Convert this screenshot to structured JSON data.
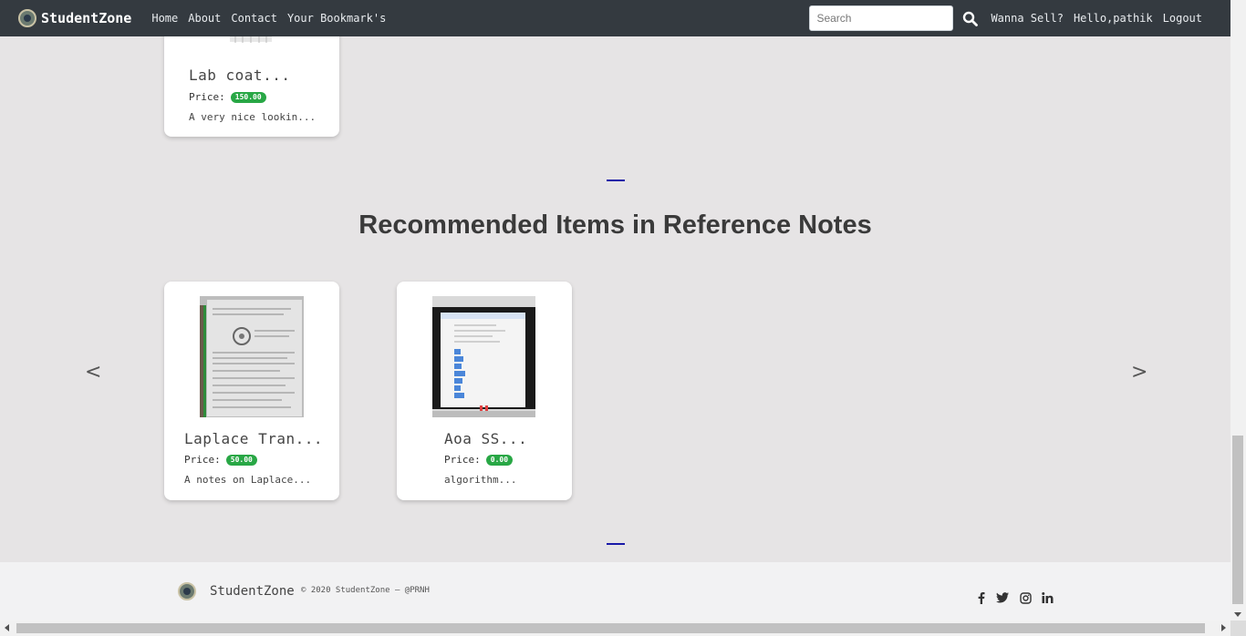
{
  "navbar": {
    "brand": "StudentZone",
    "links": [
      "Home",
      "About",
      "Contact",
      "Your Bookmark's"
    ],
    "search_placeholder": "Search",
    "right": [
      "Wanna Sell?",
      "Hello,pathik",
      "Logout"
    ]
  },
  "previous_section": {
    "cards": [
      {
        "title": "Lab coat...",
        "price_label": "Price:",
        "price": "150.00",
        "desc": "A very nice lookin..."
      }
    ]
  },
  "reference_section": {
    "heading": "Recommended Items in Reference Notes",
    "prev_arrow": "<",
    "next_arrow": ">",
    "cards": [
      {
        "title": "Laplace Tran...",
        "price_label": "Price:",
        "price": "50.00",
        "desc": "A notes on Laplace..."
      },
      {
        "title": "Aoa SS...",
        "price_label": "Price:",
        "price": "0.00",
        "desc": "algorithm..."
      }
    ]
  },
  "footer": {
    "brand": "StudentZone",
    "copyright": "© 2020 StudentZone — @PRNH",
    "social_icons": [
      "facebook-icon",
      "twitter-icon",
      "instagram-icon",
      "linkedin-icon"
    ]
  },
  "colors": {
    "navbar_bg": "#343a40",
    "page_bg": "#e6e4e5",
    "price_badge": "#28a745",
    "divider": "#1a1aa8"
  }
}
